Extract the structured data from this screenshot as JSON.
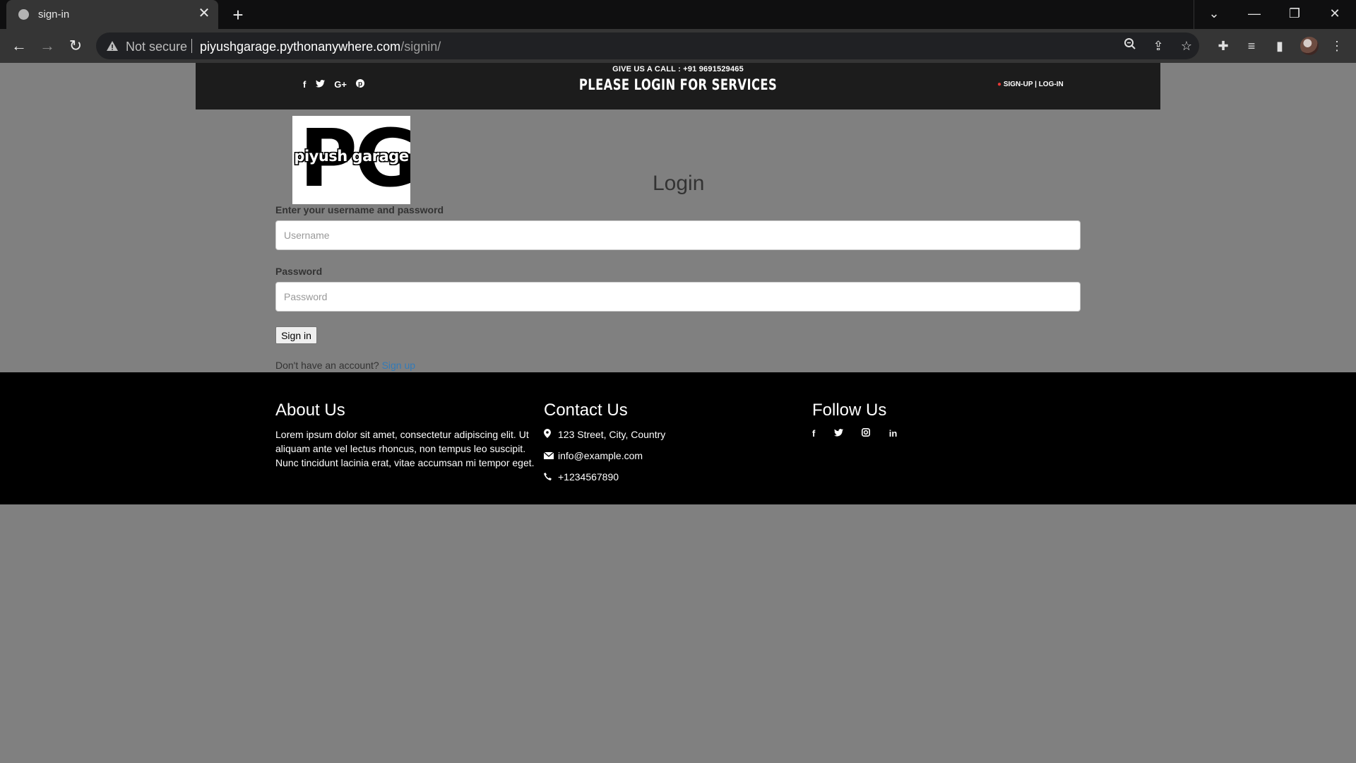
{
  "browser": {
    "tab_title": "sign-in",
    "security_label": "Not secure",
    "url_host": "piyushgarage.pythonanywhere.com",
    "url_path": "/signin/"
  },
  "header": {
    "call_text": "GIVE US A CALL : +91 9691529465",
    "title": "PLEASE LOGIN FOR SERVICES",
    "signup_label": "SIGN-UP",
    "divider": "|",
    "login_label": "LOG-IN",
    "social": [
      "f",
      "t",
      "G+",
      "p"
    ]
  },
  "logo": {
    "letters": "PG",
    "text": "piyush garage"
  },
  "login": {
    "title": "Login",
    "instruction": "Enter your username and password",
    "username_placeholder": "Username",
    "password_label": "Password",
    "password_placeholder": "Password",
    "submit_label": "Sign in",
    "no_account_text": "Don't have an account?",
    "signup_link": "Sign up"
  },
  "footer": {
    "about_title": "About Us",
    "about_text": "Lorem ipsum dolor sit amet, consectetur adipiscing elit. Ut aliquam ante vel lectus rhoncus, non tempus leo suscipit. Nunc tincidunt lacinia erat, vitae accumsan mi tempor eget.",
    "contact_title": "Contact Us",
    "address": "123 Street, City, Country",
    "email": "info@example.com",
    "phone": "+1234567890",
    "follow_title": "Follow Us"
  }
}
